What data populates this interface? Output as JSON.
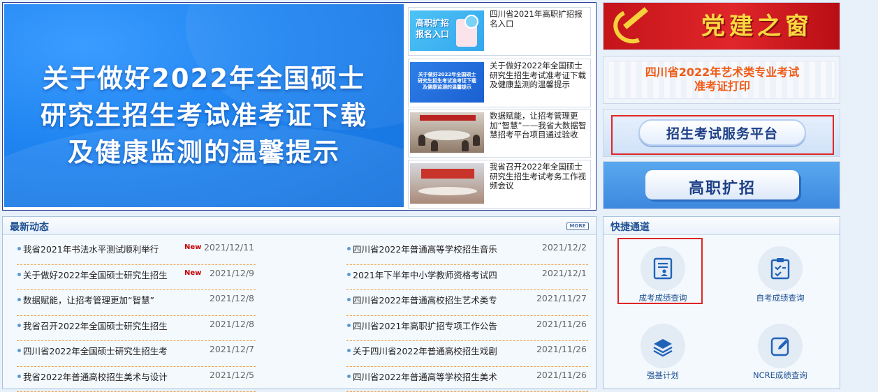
{
  "hero": {
    "title_line1": "关于做好2022年全国硕士",
    "title_line2": "研究生招生考试准考证下载",
    "title_line3": "及健康监测的温馨提示"
  },
  "news_cards": [
    {
      "thumb_text": "高职扩招\n报名入口",
      "text": "四川省2021年高职扩招报名入口"
    },
    {
      "thumb_text": "关于做好2022年全国硕士\n研究生招生考试准考证下载\n及健康监测的温馨提示",
      "text": "关于做好2022年全国硕士研究生招生考试准考证下载及健康监测的温馨提示"
    },
    {
      "text": "数据赋能，让招考管理更加“智慧”——我省大数据智慧招考平台项目通过验收"
    },
    {
      "text": "我省召开2022年全国硕士研究生招生考试考务工作视频会议"
    }
  ],
  "side_banners": {
    "party": "党建之窗",
    "art_line1": "四川省2022年艺术类专业考试",
    "art_line2": "准考证打印",
    "platform": "招生考试服务平台",
    "vocational": "高职扩招"
  },
  "news": {
    "title": "最新动态",
    "more": "MORE",
    "new_badge": "New",
    "left": [
      {
        "title": "我省2021年书法水平测试顺利举行",
        "date": "2021/12/11",
        "is_new": true
      },
      {
        "title": "关于做好2022年全国硕士研究生招生",
        "date": "2021/12/9",
        "is_new": true
      },
      {
        "title": "数据赋能，让招考管理更加“智慧”",
        "date": "2021/12/8",
        "is_new": false
      },
      {
        "title": "我省召开2022年全国硕士研究生招生",
        "date": "2021/12/8",
        "is_new": false
      },
      {
        "title": "四川省2022年全国硕士研究生招生考",
        "date": "2021/12/7",
        "is_new": false
      },
      {
        "title": "我省2022年普通高校招生美术与设计",
        "date": "2021/12/5",
        "is_new": false
      }
    ],
    "right": [
      {
        "title": "四川省2022年普通高等学校招生音乐",
        "date": "2021/12/2"
      },
      {
        "title": "2021年下半年中小学教师资格考试四",
        "date": "2021/12/1"
      },
      {
        "title": "四川省2022年普通高校招生艺术类专",
        "date": "2021/11/27"
      },
      {
        "title": "四川省2021年高职扩招专项工作公告",
        "date": "2021/11/26"
      },
      {
        "title": "关于四川省2022年普通高校招生戏剧",
        "date": "2021/11/26"
      },
      {
        "title": "四川省2022年普通高等学校招生美术",
        "date": "2021/11/26"
      }
    ]
  },
  "quick": {
    "title": "快捷通道",
    "items": [
      {
        "label": "成考成绩查询",
        "icon": "document-user-icon"
      },
      {
        "label": "自考成绩查询",
        "icon": "clipboard-check-icon"
      },
      {
        "label": "强基计划",
        "icon": "layers-icon"
      },
      {
        "label": "NCRE成绩查询",
        "icon": "edit-square-icon"
      }
    ]
  },
  "colors": {
    "accent": "#1d4f91",
    "new_red": "#c80000",
    "highlight": "#e02626",
    "dash": "#f0a24b"
  }
}
